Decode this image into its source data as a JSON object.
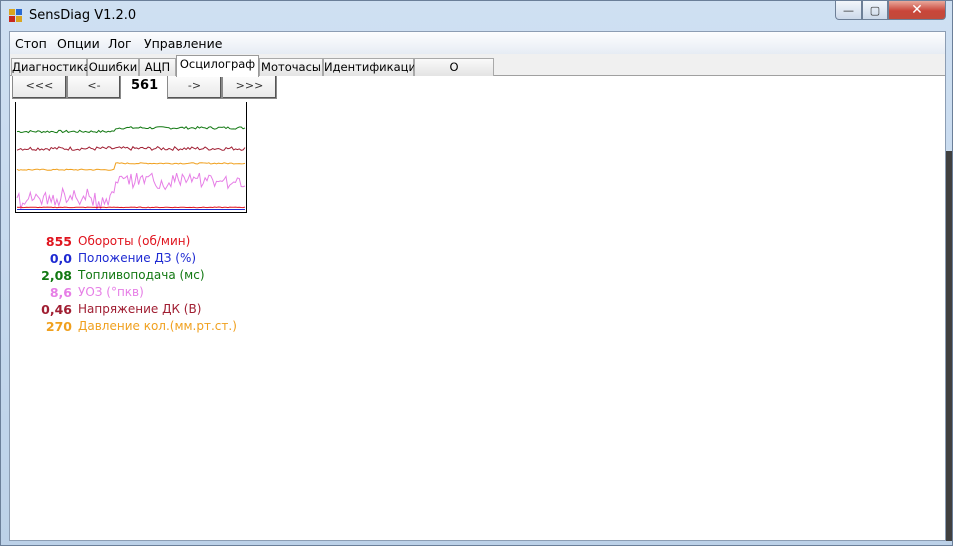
{
  "window": {
    "title": "SensDiag V1.2.0"
  },
  "titlebar_buttons": {
    "minimize": "—",
    "maximize": "▢",
    "close": "✕"
  },
  "menu": [
    {
      "label": "Стоп"
    },
    {
      "label": "Опции"
    },
    {
      "label": "Лог"
    },
    {
      "label": "Управление"
    }
  ],
  "tabs": [
    {
      "label": "Диагностика",
      "active": false
    },
    {
      "label": "Ошибки",
      "active": false
    },
    {
      "label": "АЦП",
      "active": false
    },
    {
      "label": "Осцилограф",
      "active": true
    },
    {
      "label": "Моточасы",
      "active": false
    },
    {
      "label": "Идентификация",
      "active": false
    },
    {
      "label": "О программе",
      "active": false
    }
  ],
  "navigation": {
    "first_label": "<<<",
    "prev_label": "<-",
    "frame_number": "561",
    "next_label": "->",
    "last_label": ">>>"
  },
  "readings": [
    {
      "value": "855",
      "label": "Обороты (об/мин)",
      "color": "#e0141e"
    },
    {
      "value": "0,0",
      "label": "Положение ДЗ (%)",
      "color": "#1e2ad2"
    },
    {
      "value": "2,08",
      "label": "Топливоподача (мс)",
      "color": "#127812"
    },
    {
      "value": "8,6",
      "label": "УОЗ (°пкв)",
      "color": "#e67ee6"
    },
    {
      "value": "0,46",
      "label": "Напряжение ДК (В)",
      "color": "#a01e32"
    },
    {
      "value": "270",
      "label": "Давление кол.(мм.рт.ст.)",
      "color": "#f0a01e"
    }
  ],
  "chart_data": {
    "type": "line",
    "title": "",
    "xlabel": "",
    "ylabel": "",
    "series": [
      {
        "name": "Топливоподача (мс)",
        "color": "#127812",
        "base": 0.74,
        "shift": 0.035,
        "noise": 0.012
      },
      {
        "name": "Напряжение ДК (В)",
        "color": "#a01e32",
        "base": 0.58,
        "shift": 0.0,
        "noise": 0.018
      },
      {
        "name": "Давление кол.(мм.рт.ст.)",
        "color": "#f0a01e",
        "base": 0.38,
        "shift": 0.06,
        "noise": 0.006
      },
      {
        "name": "УОЗ (°пкв)",
        "color": "#e67ee6",
        "base": 0.11,
        "shift": 0.17,
        "noise": 0.07
      },
      {
        "name": "Обороты (об/мин)",
        "color": "#e0141e",
        "base": 0.025,
        "shift": 0.0,
        "noise": 0.003
      },
      {
        "name": "Положение ДЗ (%)",
        "color": "#1e2ad2",
        "base": 0.005,
        "shift": 0.0,
        "noise": 0.0
      }
    ],
    "shift_at": 0.43,
    "samples": 120
  }
}
